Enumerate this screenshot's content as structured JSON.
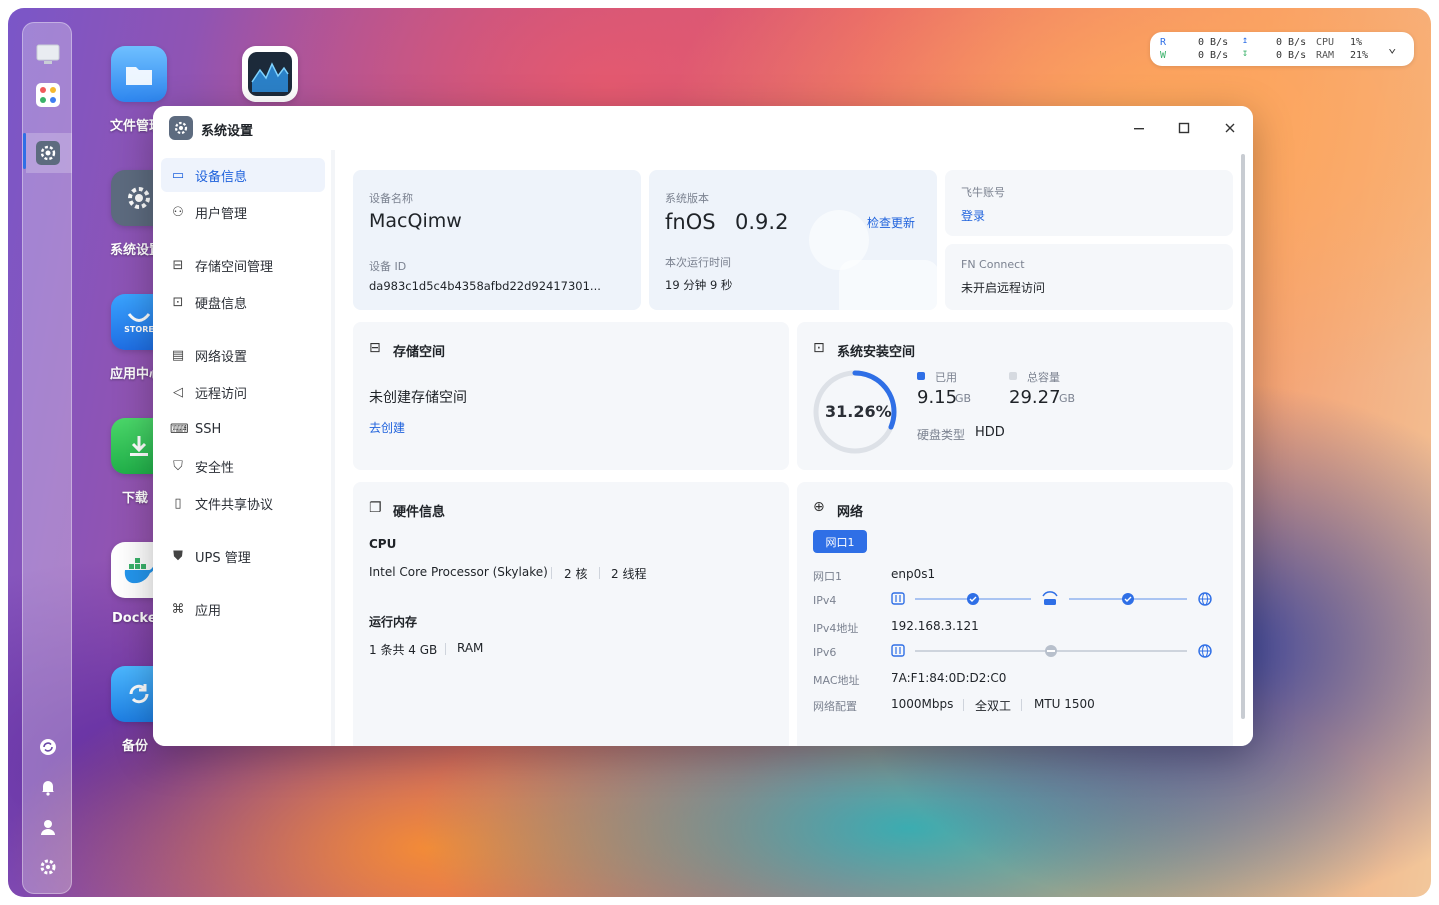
{
  "desktop": {
    "icons": [
      {
        "label": "文件管理",
        "name": "file-manager"
      },
      {
        "label": "系统设置",
        "name": "system-settings"
      },
      {
        "label": "应用中心",
        "name": "app-center",
        "badge": "STORE"
      },
      {
        "label": "下载",
        "name": "download"
      },
      {
        "label": "Docker",
        "name": "docker"
      },
      {
        "label": "备份",
        "name": "backup"
      }
    ]
  },
  "monitor": {
    "r_label": "R",
    "w_label": "W",
    "r_val": "0 B/s",
    "w_val": "0 B/s",
    "up_val": "0 B/s",
    "down_val": "0 B/s",
    "cpu_label": "CPU",
    "ram_label": "RAM",
    "cpu_val": "1%",
    "ram_val": "21%"
  },
  "window": {
    "title": "系统设置"
  },
  "sidebar": {
    "items": [
      {
        "label": "设备信息"
      },
      {
        "label": "用户管理"
      },
      {
        "label": "存储空间管理"
      },
      {
        "label": "硬盘信息"
      },
      {
        "label": "网络设置"
      },
      {
        "label": "远程访问"
      },
      {
        "label": "SSH"
      },
      {
        "label": "安全性"
      },
      {
        "label": "文件共享协议"
      },
      {
        "label": "UPS 管理"
      },
      {
        "label": "应用"
      }
    ]
  },
  "device": {
    "name_label": "设备名称",
    "name_value": "MacQimw",
    "id_label": "设备 ID",
    "id_value": "da983c1d5c4b4358afbd22d92417301..."
  },
  "version": {
    "label": "系统版本",
    "os": "fnOS",
    "value": "0.9.2",
    "check_update": "检查更新",
    "uptime_label": "本次运行时间",
    "uptime_value": "19 分钟 9 秒"
  },
  "account": {
    "label": "飞牛账号",
    "login": "登录"
  },
  "fnconnect": {
    "label": "FN Connect",
    "value": "未开启远程访问"
  },
  "storage": {
    "title": "存储空间",
    "empty": "未创建存储空间",
    "create": "去创建"
  },
  "system_space": {
    "title": "系统安装空间",
    "percent_text": "31.26%",
    "percent": 31.26,
    "used_label": "已用",
    "used_value": "9.15",
    "used_unit": "GB",
    "total_label": "总容量",
    "total_value": "29.27",
    "total_unit": "GB",
    "disk_type_label": "硬盘类型",
    "disk_type_value": "HDD",
    "accent": "#2f6fe6"
  },
  "hardware": {
    "title": "硬件信息",
    "cpu_label": "CPU",
    "cpu_model": "Intel Core Processor (Skylake)",
    "cpu_cores": "2 核",
    "cpu_threads": "2 线程",
    "mem_label": "运行内存",
    "mem_value": "1 条共 4 GB",
    "mem_type": "RAM"
  },
  "network": {
    "title": "网络",
    "tab": "网口1",
    "rows": [
      {
        "label": "网口1",
        "value": "enp0s1"
      },
      {
        "label": "IPv4",
        "value": ""
      },
      {
        "label": "IPv4地址",
        "value": "192.168.3.121"
      },
      {
        "label": "IPv6",
        "value": ""
      },
      {
        "label": "MAC地址",
        "value": "7A:F1:84:0D:D2:C0"
      },
      {
        "label": "网络配置",
        "value": "1000Mbps"
      }
    ],
    "duplex": "全双工",
    "mtu": "MTU 1500"
  }
}
